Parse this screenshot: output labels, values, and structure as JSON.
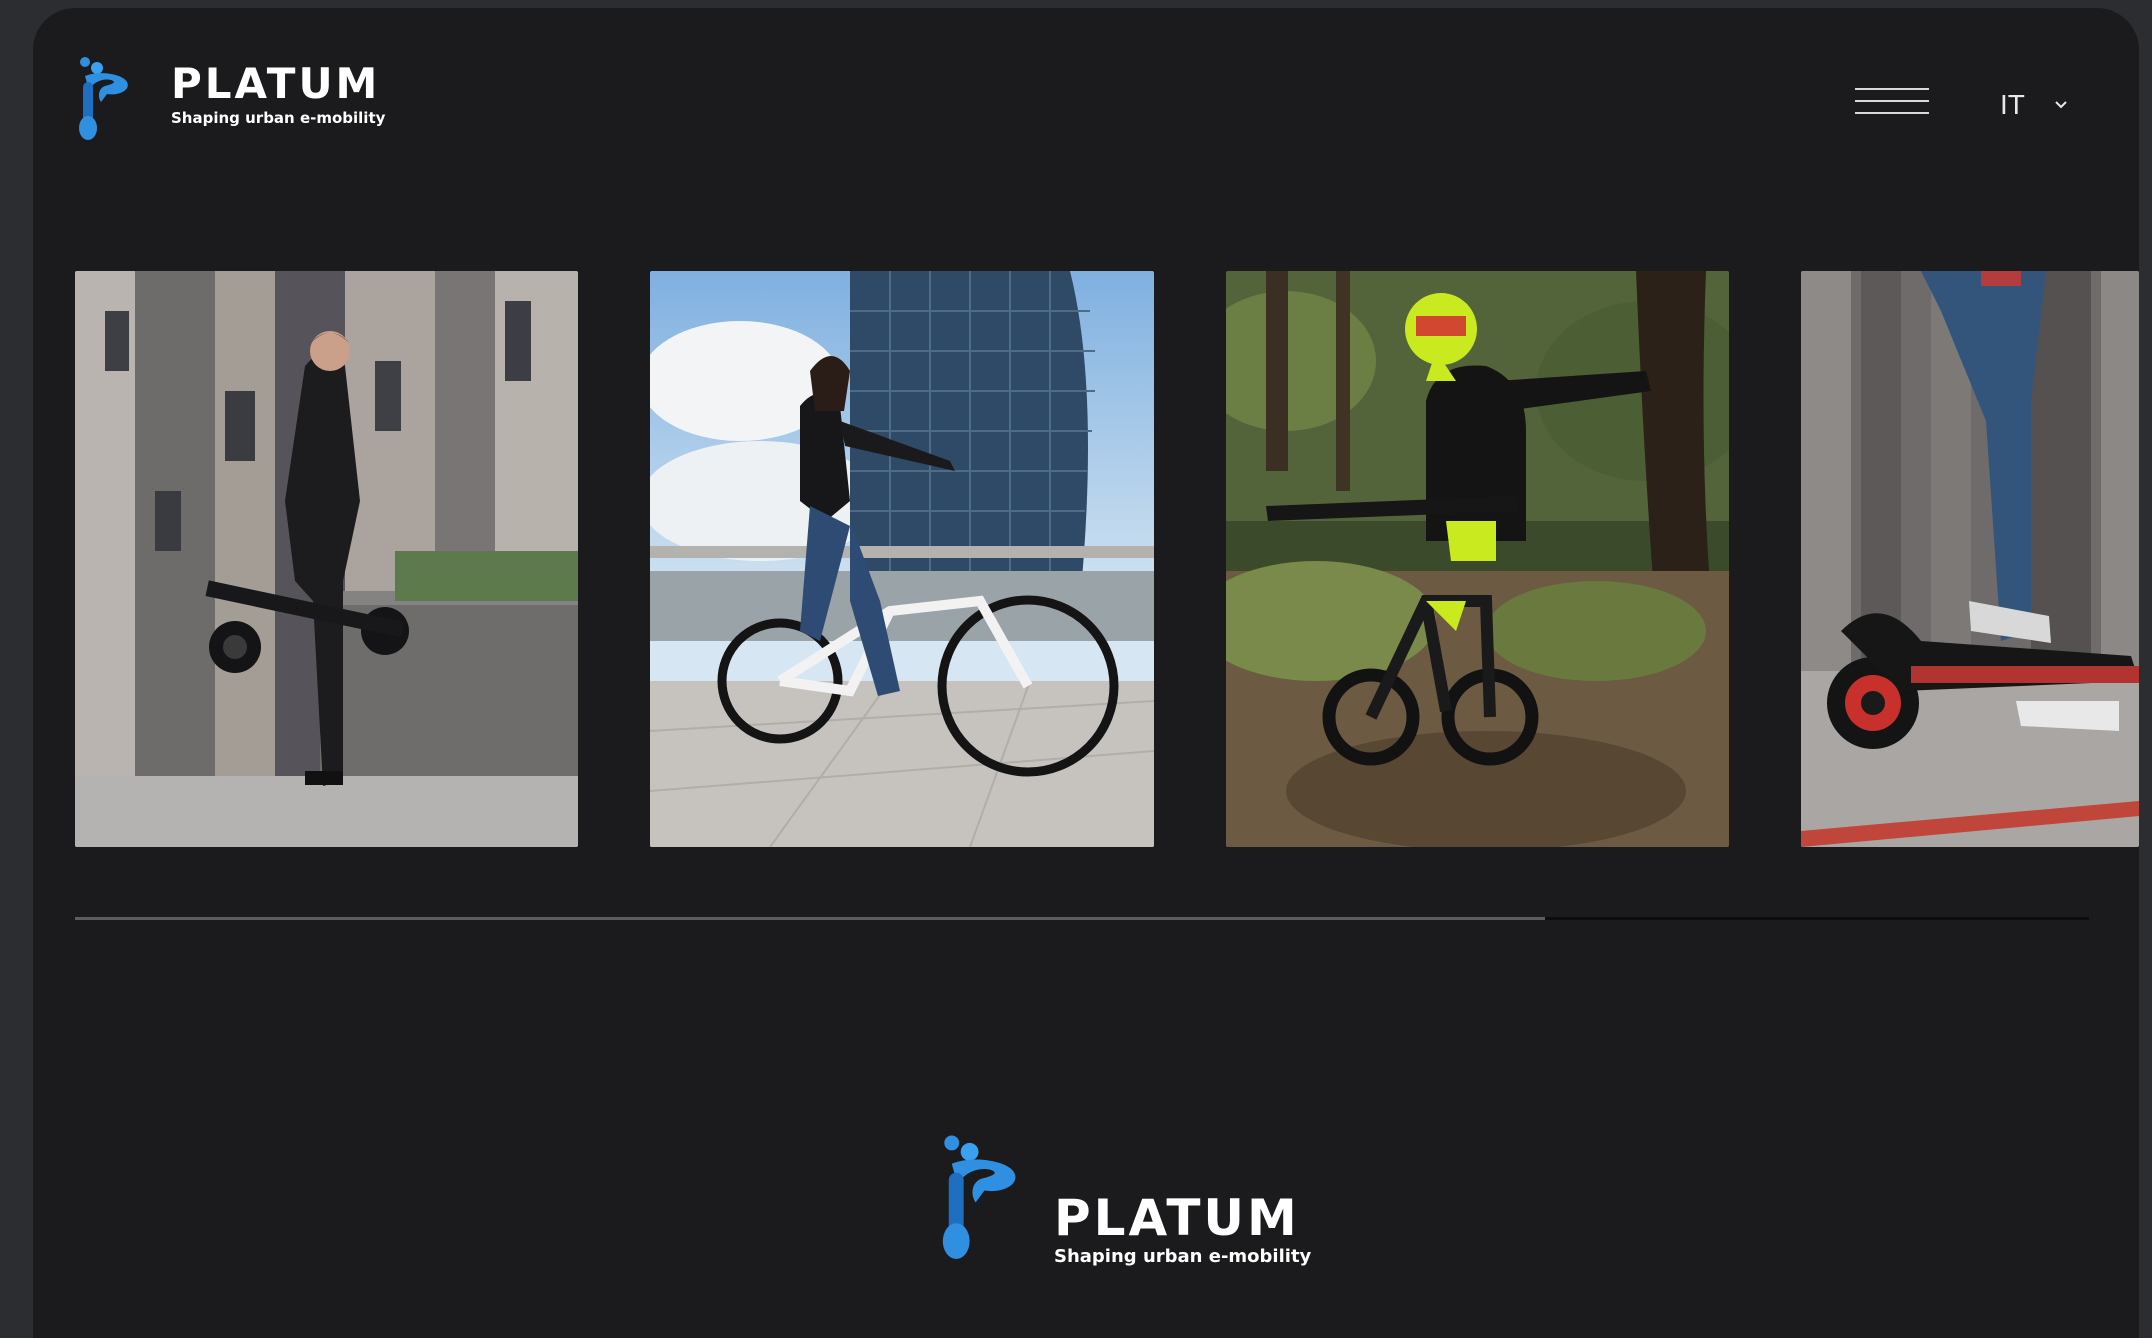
{
  "header": {
    "brand_name": "PLATUM",
    "brand_tagline": "Shaping urban e-mobility",
    "language": "IT"
  },
  "gallery": {
    "items": [
      {
        "name": "man-with-folding-scooter"
      },
      {
        "name": "woman-on-city-ebike"
      },
      {
        "name": "rider-on-emtb"
      },
      {
        "name": "person-on-scooter"
      }
    ],
    "scroll_progress": 0.73
  },
  "footer": {
    "brand_name": "PLATUM",
    "brand_tagline": "Shaping urban e-mobility"
  },
  "colors": {
    "background": "#1b1b1d",
    "brand_blue": "#2f8fe0",
    "text": "#ffffff"
  }
}
